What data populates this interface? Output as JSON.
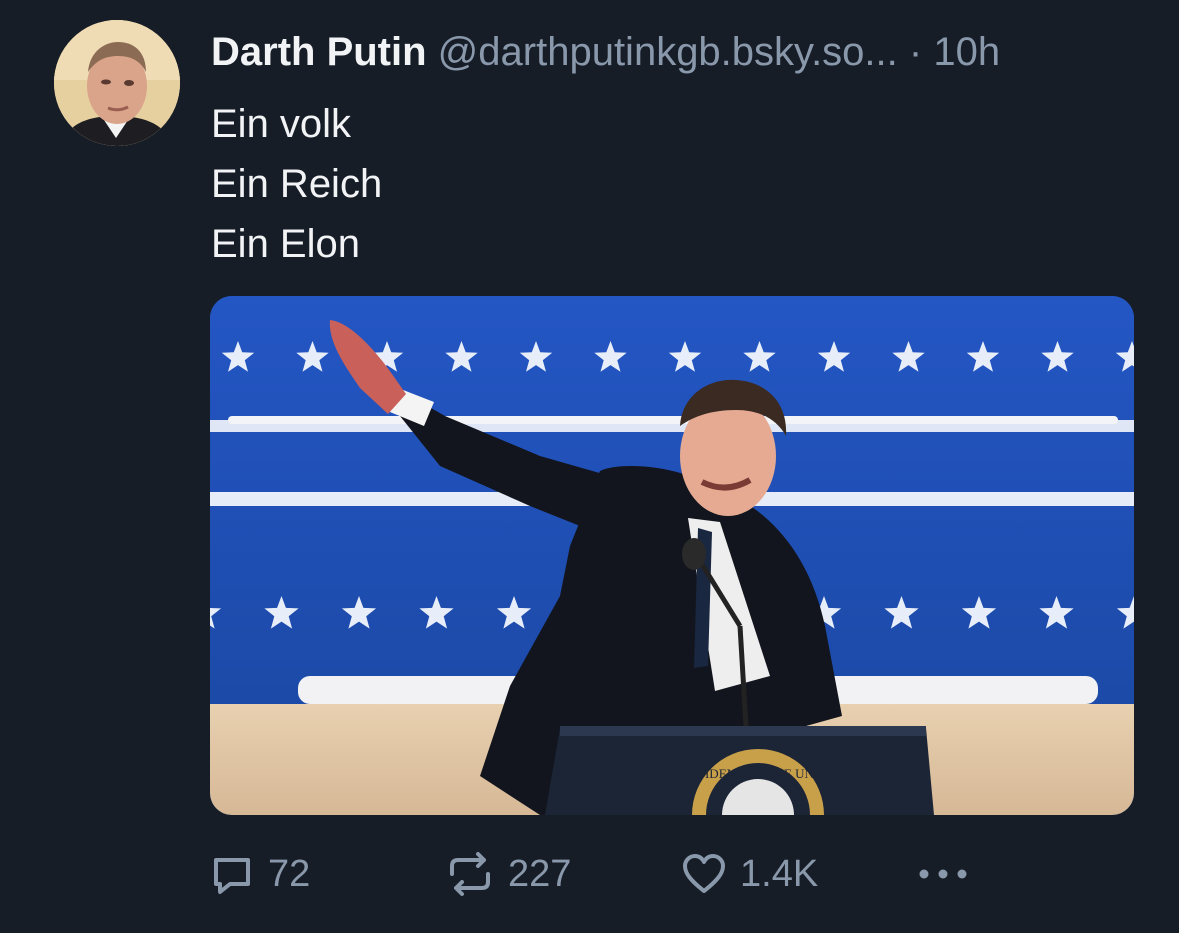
{
  "post": {
    "author_name": "Darth Putin",
    "handle": "@darthputinkgb.bsky.so...",
    "separator": "·",
    "time": "10h",
    "lines": [
      "Ein volk",
      "Ein Reich",
      "Ein Elon"
    ]
  },
  "actions": {
    "replies": "72",
    "reposts": "227",
    "likes": "1.4K"
  },
  "media": {
    "seal_text": "SIDENT OF THE UNI"
  },
  "colors": {
    "background": "#161d27",
    "text": "#f1f3f5",
    "muted": "#8a98ab",
    "backdrop_blue": "#1f4fb2"
  },
  "icons": {
    "reply": "speech-bubble",
    "repost": "repeat-arrows",
    "like": "heart-outline",
    "more": "three-dots"
  }
}
